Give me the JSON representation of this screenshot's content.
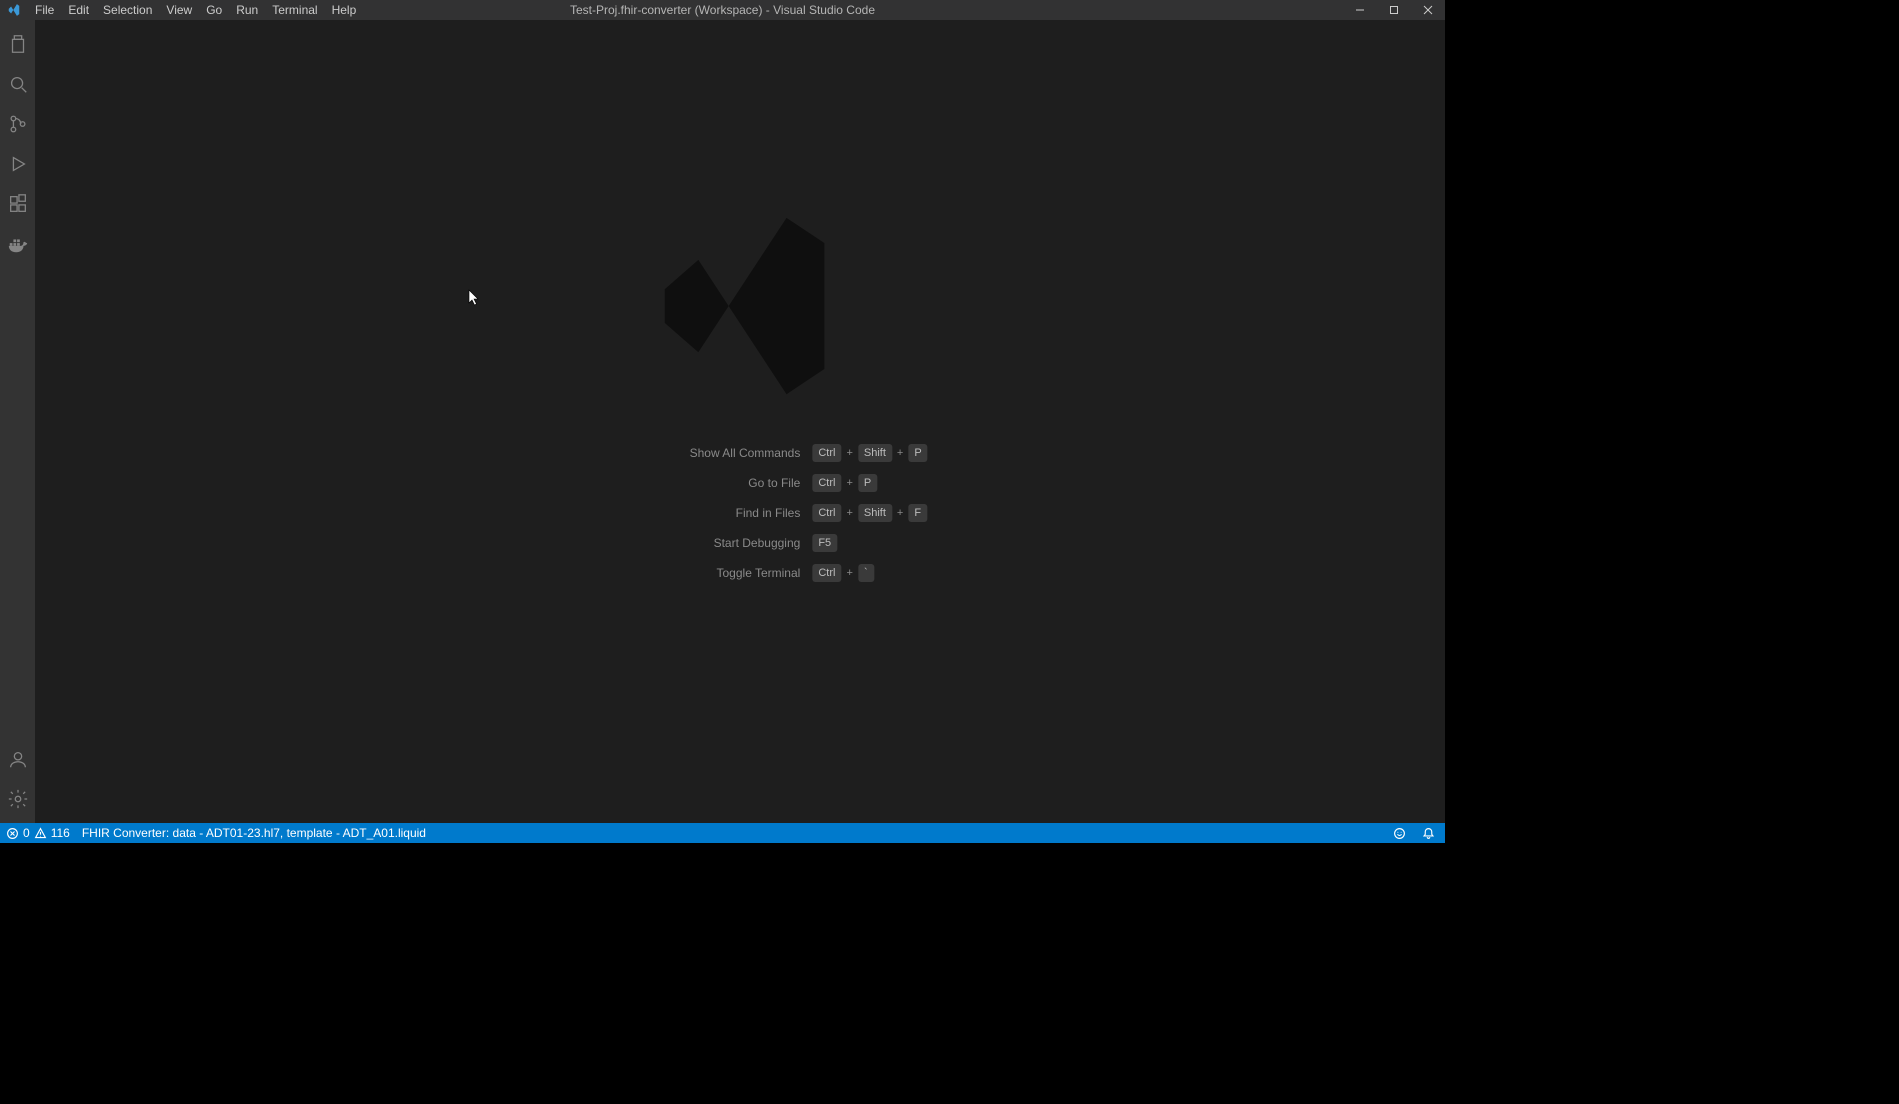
{
  "title": "Test-Proj.fhir-converter (Workspace) - Visual Studio Code",
  "menu": {
    "file": "File",
    "edit": "Edit",
    "selection": "Selection",
    "view": "View",
    "go": "Go",
    "run": "Run",
    "terminal": "Terminal",
    "help": "Help"
  },
  "activity_icons": {
    "explorer": "explorer-icon",
    "search": "search-icon",
    "scm": "source-control-icon",
    "debug": "run-debug-icon",
    "extensions": "extensions-icon",
    "docker": "docker-icon",
    "accounts": "accounts-icon",
    "settings": "gear-icon"
  },
  "shortcuts": [
    {
      "label": "Show All Commands",
      "keys": [
        "Ctrl",
        "Shift",
        "P"
      ]
    },
    {
      "label": "Go to File",
      "keys": [
        "Ctrl",
        "P"
      ]
    },
    {
      "label": "Find in Files",
      "keys": [
        "Ctrl",
        "Shift",
        "F"
      ]
    },
    {
      "label": "Start Debugging",
      "keys": [
        "F5"
      ]
    },
    {
      "label": "Toggle Terminal",
      "keys": [
        "Ctrl",
        "`"
      ]
    }
  ],
  "status": {
    "errors": "0",
    "warnings": "116",
    "fhir": "FHIR Converter: data - ADT01-23.hl7, template - ADT_A01.liquid"
  },
  "window_controls": {
    "minimize": "minimize",
    "maximize": "maximize",
    "close": "close"
  }
}
